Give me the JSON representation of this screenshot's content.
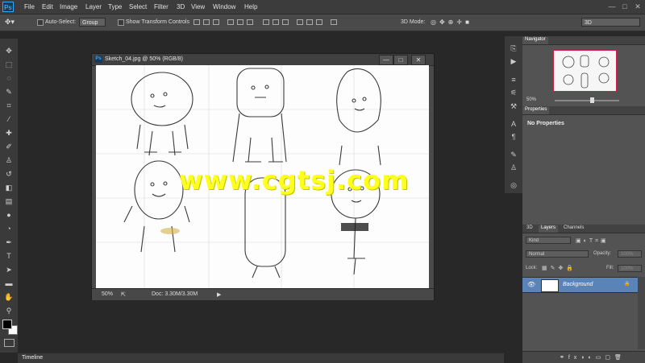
{
  "app": {
    "logo": "Ps"
  },
  "menu": [
    "File",
    "Edit",
    "Image",
    "Layer",
    "Type",
    "Select",
    "Filter",
    "3D",
    "View",
    "Window",
    "Help"
  ],
  "window_controls": {
    "minimize": "—",
    "maximize": "□",
    "close": "✕"
  },
  "options_bar": {
    "auto_select_label": "Auto-Select:",
    "auto_select_value": "Group",
    "show_transform_label": "Show Transform Controls",
    "mode_3d_label": "3D Mode:",
    "workspace_value": "3D"
  },
  "document": {
    "title": "Sketch_04.jpg @ 50% (RGB/8)",
    "zoom": "50%",
    "doc_size": "Doc: 3.30M/3.30M"
  },
  "watermark_text": "www.cgtsj.com",
  "panels": {
    "navigator": {
      "tab": "Navigator",
      "zoom": "50%",
      "view_fraction": 0.55
    },
    "properties": {
      "tab": "Properties",
      "message": "No Properties"
    },
    "layers": {
      "tabs": [
        "3D",
        "Layers",
        "Channels"
      ],
      "filter_kind": "Kind",
      "blend_mode": "Normal",
      "opacity_label": "Opacity:",
      "opacity_value": "100%",
      "lock_label": "Lock:",
      "fill_label": "Fill:",
      "fill_value": "100%",
      "layer_name": "Background"
    }
  },
  "timeline": {
    "tab": "Timeline"
  },
  "colors": {
    "foreground": "#000000",
    "background": "#ffffff",
    "accent": "#31a8ff",
    "layer_selected": "#5a83b7",
    "watermark": "#ffff1e"
  },
  "tool_icons": [
    "move-icon",
    "marquee-icon",
    "lasso-icon",
    "quick-select-icon",
    "crop-icon",
    "eyedropper-icon",
    "healing-brush-icon",
    "brush-icon",
    "clone-stamp-icon",
    "history-brush-icon",
    "eraser-icon",
    "gradient-icon",
    "blur-icon",
    "dodge-icon",
    "pen-icon",
    "type-icon",
    "path-select-icon",
    "shape-icon",
    "hand-icon",
    "zoom-icon"
  ]
}
